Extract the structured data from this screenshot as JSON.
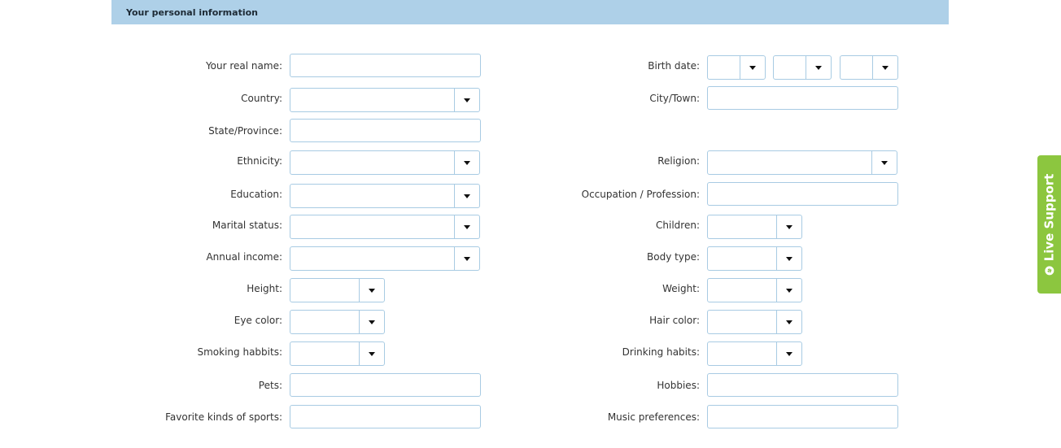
{
  "section": {
    "title": "Your personal information"
  },
  "live_support": {
    "label": "Live Support",
    "icon": "lifebuoy-icon",
    "color": "#8cc63f"
  },
  "colors": {
    "header_bg": "#aed0e8",
    "field_border": "#a8cbe3"
  },
  "left": {
    "real_name": {
      "label": "Your real name:",
      "value": ""
    },
    "country": {
      "label": "Country:",
      "value": ""
    },
    "state": {
      "label": "State/Province:",
      "value": ""
    },
    "ethnicity": {
      "label": "Ethnicity:",
      "value": ""
    },
    "education": {
      "label": "Education:",
      "value": ""
    },
    "marital": {
      "label": "Marital status:",
      "value": ""
    },
    "income": {
      "label": "Annual income:",
      "value": ""
    },
    "height": {
      "label": "Height:",
      "value": ""
    },
    "eye_color": {
      "label": "Eye color:",
      "value": ""
    },
    "smoking": {
      "label": "Smoking habbits:",
      "value": ""
    },
    "pets": {
      "label": "Pets:",
      "value": ""
    },
    "sports": {
      "label": "Favorite kinds of sports:",
      "value": ""
    }
  },
  "right": {
    "birth_date": {
      "label": "Birth date:",
      "day": "",
      "month": "",
      "year": ""
    },
    "city": {
      "label": "City/Town:",
      "value": ""
    },
    "religion": {
      "label": "Religion:",
      "value": ""
    },
    "occupation": {
      "label": "Occupation / Profession:",
      "value": ""
    },
    "children": {
      "label": "Children:",
      "value": ""
    },
    "body_type": {
      "label": "Body type:",
      "value": ""
    },
    "weight": {
      "label": "Weight:",
      "value": ""
    },
    "hair_color": {
      "label": "Hair color:",
      "value": ""
    },
    "drinking": {
      "label": "Drinking habits:",
      "value": ""
    },
    "hobbies": {
      "label": "Hobbies:",
      "value": ""
    },
    "music": {
      "label": "Music preferences:",
      "value": ""
    }
  }
}
